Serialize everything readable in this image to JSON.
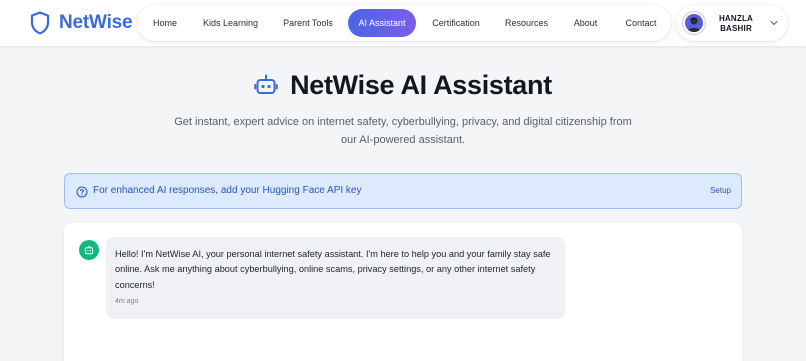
{
  "brand": {
    "name": "NetWise",
    "icon": "shield-icon",
    "color": "#3a6bd8"
  },
  "nav": {
    "items": [
      {
        "label": "Home",
        "active": false
      },
      {
        "label": "Kids Learning",
        "active": false
      },
      {
        "label": "Parent Tools",
        "active": false
      },
      {
        "label": "AI Assistant",
        "active": true
      },
      {
        "label": "Certification",
        "active": false
      },
      {
        "label": "Resources",
        "active": false
      },
      {
        "label": "About",
        "active": false
      },
      {
        "label": "Contact",
        "active": false
      }
    ],
    "active_gradient": [
      "#4a66e6",
      "#7b5ee8"
    ]
  },
  "user": {
    "name_line1": "HANZLA",
    "name_line2": "BASHIR",
    "avatar_icon": "user-avatar",
    "caret_icon": "chevron-down-icon"
  },
  "hero": {
    "icon": "robot-icon",
    "title": "NetWise AI Assistant",
    "subtitle": "Get instant, expert advice on internet safety, cyberbullying, privacy, and digital citizenship from our AI-powered assistant."
  },
  "banner": {
    "icon": "help-circle-icon",
    "text": "For enhanced AI responses, add your Hugging Face API key",
    "action": "Setup",
    "bg": "#dde9fd",
    "border": "#9dbcf2"
  },
  "chat": {
    "messages": [
      {
        "sender": "assistant",
        "avatar_icon": "robot-icon",
        "avatar_color": "#10b981",
        "text": "Hello! I'm NetWise AI, your personal internet safety assistant. I'm here to help you and your family stay safe online. Ask me anything about cyberbullying, online scams, privacy settings, or any other internet safety concerns!",
        "time": "4m ago"
      }
    ]
  }
}
